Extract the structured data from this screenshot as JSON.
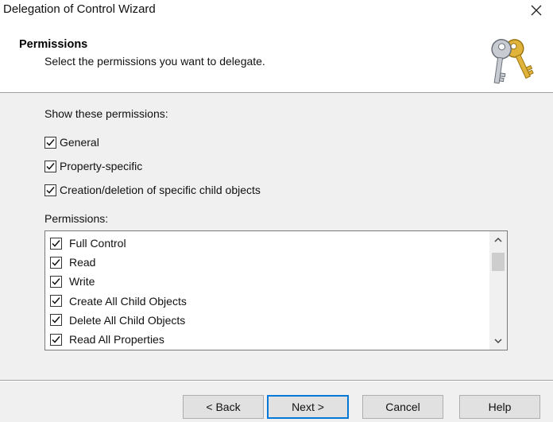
{
  "window": {
    "title": "Delegation of Control Wizard",
    "close_icon": "close-icon"
  },
  "header": {
    "title": "Permissions",
    "subtitle": "Select the permissions you want to delegate.",
    "icon": "keys-icon"
  },
  "show": {
    "label": "Show these permissions:",
    "options": [
      {
        "label": "General",
        "checked": true
      },
      {
        "label": "Property-specific",
        "checked": true
      },
      {
        "label": "Creation/deletion of specific child objects",
        "checked": true
      }
    ]
  },
  "permissions": {
    "label": "Permissions:",
    "items": [
      {
        "label": "Full Control",
        "checked": true
      },
      {
        "label": "Read",
        "checked": true
      },
      {
        "label": "Write",
        "checked": true
      },
      {
        "label": "Create All Child Objects",
        "checked": true
      },
      {
        "label": "Delete All Child Objects",
        "checked": true
      },
      {
        "label": "Read All Properties",
        "checked": true
      }
    ]
  },
  "buttons": {
    "back": "< Back",
    "next": "Next >",
    "cancel": "Cancel",
    "help": "Help"
  },
  "colors": {
    "window_bg": "#f0f0f0",
    "header_bg": "#ffffff",
    "default_button_border": "#0078d7",
    "key_gold": "#d4a017",
    "key_silver": "#b8bcc2"
  }
}
